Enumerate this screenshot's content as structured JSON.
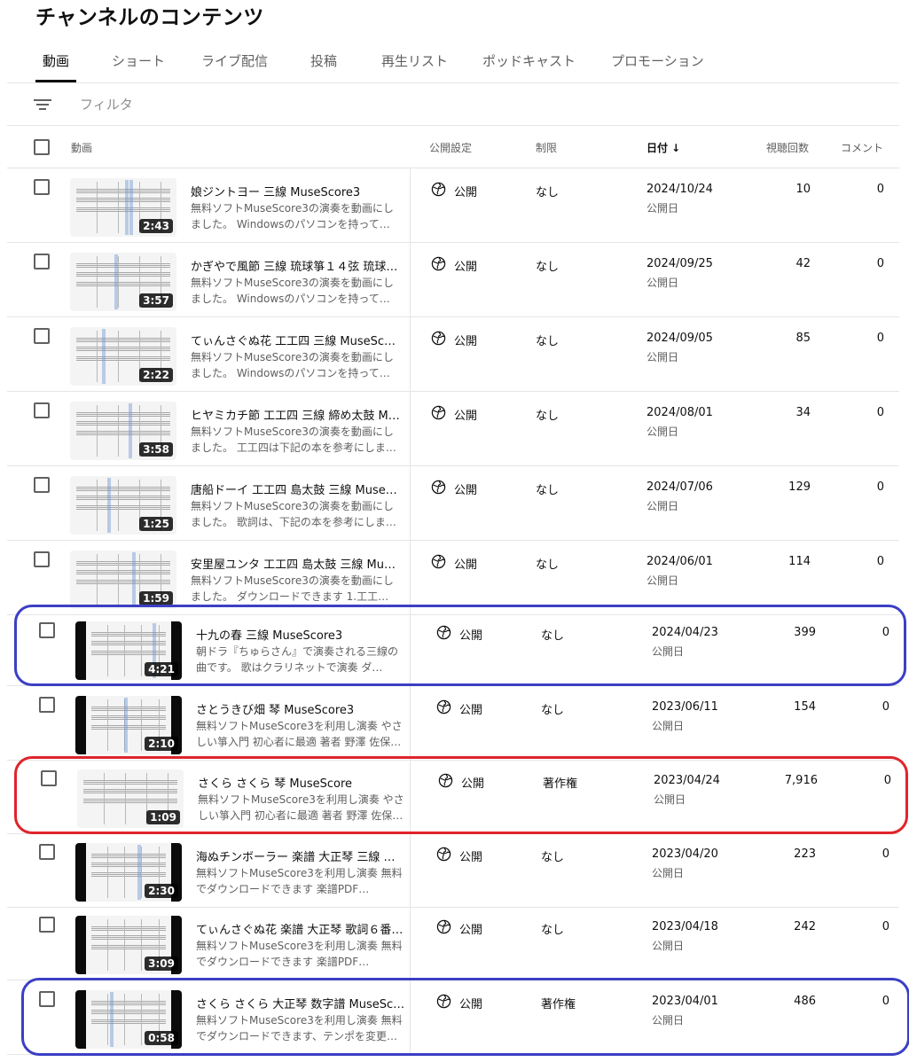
{
  "page": {
    "title": "チャンネルのコンテンツ"
  },
  "tabs": [
    {
      "label": "動画"
    },
    {
      "label": "ショート"
    },
    {
      "label": "ライブ配信"
    },
    {
      "label": "投稿"
    },
    {
      "label": "再生リスト"
    },
    {
      "label": "ポッドキャスト"
    },
    {
      "label": "プロモーション"
    }
  ],
  "filter": {
    "placeholder": "フィルタ"
  },
  "columns": {
    "video": "動画",
    "visibility": "公開設定",
    "restrictions": "制限",
    "date": "日付 ↓",
    "views": "視聴回数",
    "comments": "コメント"
  },
  "videos": [
    {
      "title": "娘ジントヨー 三線 MuseScore3",
      "desc": "無料ソフトMuseScore3の演奏を動画にしました。 Windowsのパソコンを持って…",
      "duration": "2:43",
      "visibility": "公開",
      "restriction": "なし",
      "date": "2024/10/24",
      "date_label": "公開日",
      "views": "10",
      "comments": "0"
    },
    {
      "title": "かぎやで風節 三線 琉球箏１４弦 琉球…",
      "desc": "無料ソフトMuseScore3の演奏を動画にしました。 Windowsのパソコンを持って…",
      "duration": "3:57",
      "visibility": "公開",
      "restriction": "なし",
      "date": "2024/09/25",
      "date_label": "公開日",
      "views": "42",
      "comments": "0"
    },
    {
      "title": "てぃんさぐぬ花 工工四 三線 MuseSco…",
      "desc": "無料ソフトMuseScore3の演奏を動画にしました。 Windowsのパソコンを持って…",
      "duration": "2:22",
      "visibility": "公開",
      "restriction": "なし",
      "date": "2024/09/05",
      "date_label": "公開日",
      "views": "85",
      "comments": "0"
    },
    {
      "title": "ヒヤミカチ節 工工四 三線 締め太鼓 M…",
      "desc": "無料ソフトMuseScore3の演奏を動画にしました。 工工四は下記の本を参考にしま…",
      "duration": "3:58",
      "visibility": "公開",
      "restriction": "なし",
      "date": "2024/08/01",
      "date_label": "公開日",
      "views": "34",
      "comments": "0"
    },
    {
      "title": "唐船ドーイ 工工四 島太鼓 三線 Muse…",
      "desc": "無料ソフトMuseScore3の演奏を動画にしました。 歌詞は、下記の本を参考にしま…",
      "duration": "1:25",
      "visibility": "公開",
      "restriction": "なし",
      "date": "2024/07/06",
      "date_label": "公開日",
      "views": "129",
      "comments": "0"
    },
    {
      "title": "安里屋ユンタ 工工四 島太鼓 三線 Mus…",
      "desc": "無料ソフトMuseScore3の演奏を動画にしました。 ダウンロードできます 1.工工…",
      "duration": "1:59",
      "visibility": "公開",
      "restriction": "なし",
      "date": "2024/06/01",
      "date_label": "公開日",
      "views": "114",
      "comments": "0"
    },
    {
      "title": "十九の春 三線 MuseScore3",
      "desc": "朝ドラ『ちゅらさん』で演奏される三線の曲です。 歌はクラリネットで演奏 ダ…",
      "duration": "4:21",
      "visibility": "公開",
      "restriction": "なし",
      "date": "2024/04/23",
      "date_label": "公開日",
      "views": "399",
      "comments": "0"
    },
    {
      "title": "さとうきび畑 琴 MuseScore3",
      "desc": "無料ソフトMuseScore3を利用し演奏 やさしい箏入門 初心者に最適 著者 野澤 佐保…",
      "duration": "2:10",
      "visibility": "公開",
      "restriction": "なし",
      "date": "2023/06/11",
      "date_label": "公開日",
      "views": "154",
      "comments": "0"
    },
    {
      "title": "さくら さくら 琴 MuseScore",
      "desc": "無料ソフトMuseScore3を利用し演奏 やさしい箏入門 初心者に最適 著者 野澤 佐保…",
      "duration": "1:09",
      "visibility": "公開",
      "restriction": "著作権",
      "date": "2023/04/24",
      "date_label": "公開日",
      "views": "7,916",
      "comments": "0"
    },
    {
      "title": "海ぬチンボーラー 楽譜 大正琴 三線 歌…",
      "desc": "無料ソフトMuseScore3を利用し演奏 無料でダウンロードできます 楽譜PDF…",
      "duration": "2:30",
      "visibility": "公開",
      "restriction": "なし",
      "date": "2023/04/20",
      "date_label": "公開日",
      "views": "223",
      "comments": "0"
    },
    {
      "title": "てぃんさぐぬ花 楽譜 大正琴 歌詞６番…",
      "desc": "無料ソフトMuseScore3を利用し演奏 無料でダウンロードできます 楽譜PDF…",
      "duration": "3:09",
      "visibility": "公開",
      "restriction": "なし",
      "date": "2023/04/18",
      "date_label": "公開日",
      "views": "242",
      "comments": "0"
    },
    {
      "title": "さくら さくら 大正琴 数字譜 MuseSc…",
      "desc": "無料ソフトMuseScore3を利用し演奏 無料でダウンロードできます、テンポを変更…",
      "duration": "0:58",
      "visibility": "公開",
      "restriction": "著作権",
      "date": "2023/04/01",
      "date_label": "公開日",
      "views": "486",
      "comments": "0"
    }
  ],
  "colors": {
    "highlight_blue": "#3b3fc4",
    "highlight_red": "#e0242b",
    "text_secondary": "#606060",
    "divider": "#e5e5e5"
  },
  "icons": {
    "filter": "filter-lines-icon",
    "visibility": "globe-icon",
    "checkbox": "checkbox-icon"
  }
}
